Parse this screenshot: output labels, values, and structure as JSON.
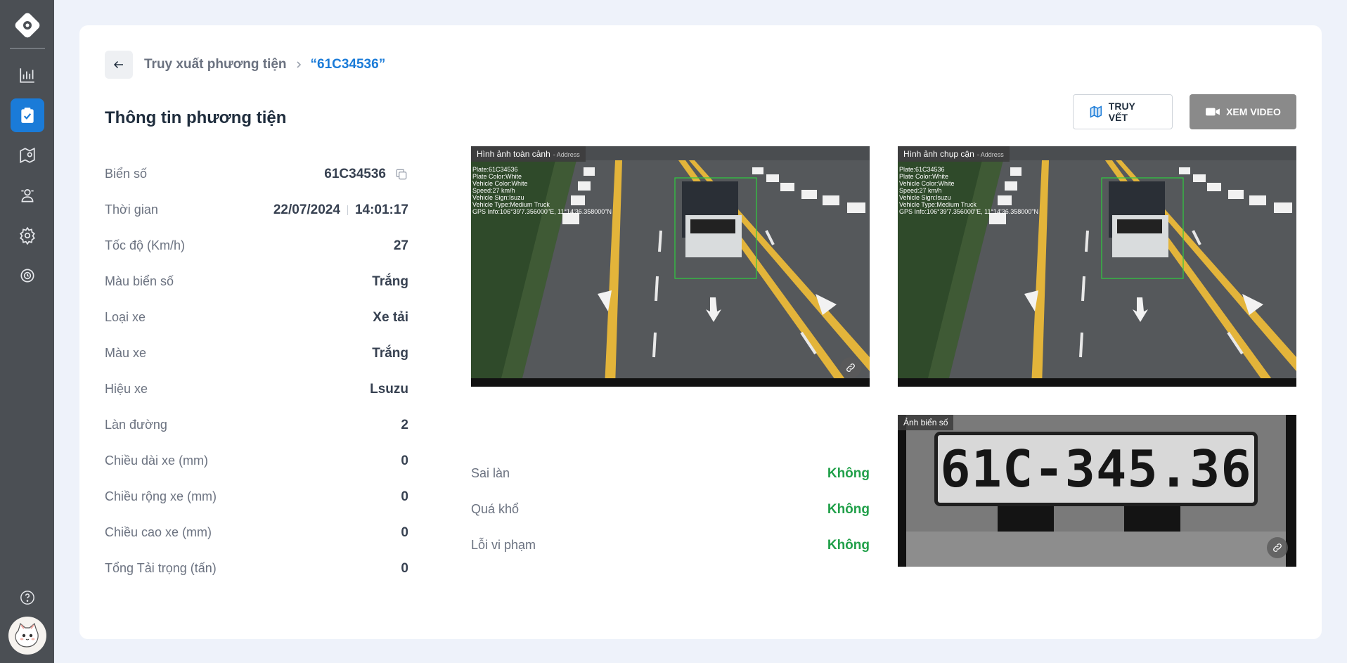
{
  "breadcrumb": {
    "parent": "Truy xuất phương tiện",
    "current": "“61C34536”"
  },
  "section_title": "Thông tin phương tiện",
  "info": {
    "plate": {
      "label": "Biển số",
      "value": "61C34536"
    },
    "time": {
      "label": "Thời gian",
      "date": "22/07/2024",
      "clock": "14:01:17"
    },
    "speed": {
      "label": "Tốc độ (Km/h)",
      "value": "27"
    },
    "plate_color": {
      "label": "Màu biển số",
      "value": "Trắng"
    },
    "vehicle_type": {
      "label": "Loại xe",
      "value": "Xe tải"
    },
    "vehicle_color": {
      "label": "Màu xe",
      "value": "Trắng"
    },
    "brand": {
      "label": "Hiệu xe",
      "value": "Lsuzu"
    },
    "lane": {
      "label": "Làn đường",
      "value": "2"
    },
    "length": {
      "label": "Chiều dài xe (mm)",
      "value": "0"
    },
    "width": {
      "label": "Chiều rộng xe (mm)",
      "value": "0"
    },
    "height": {
      "label": "Chiều cao xe (mm)",
      "value": "0"
    },
    "load": {
      "label": "Tổng Tải trọng (tấn)",
      "value": "0"
    }
  },
  "actions": {
    "trace_label": "TRUY VẾT",
    "video_label": "XEM VIDEO"
  },
  "images": {
    "overview": {
      "tag": "Hình ảnh toàn cảnh",
      "tag_extra": "- Address"
    },
    "closeup": {
      "tag": "Hình ảnh chụp cận",
      "tag_extra": "- Address"
    },
    "plate": {
      "tag": "Ảnh biển số",
      "plate_text": "61C-345.36"
    },
    "overlay_lines": [
      "Plate:61C34536",
      "Plate Color:White",
      "Vehicle Color:White",
      "Speed:27 km/h",
      "Vehicle Sign:Isuzu",
      "Vehicle Type:Medium Truck",
      "GPS Info:106°39'7.356000\"E, 11°14'36.358000\"N"
    ]
  },
  "violations": {
    "wrong_lane": {
      "label": "Sai làn",
      "value": "Không"
    },
    "oversize": {
      "label": "Quá khổ",
      "value": "Không"
    },
    "violation_error": {
      "label": "Lỗi vi phạm",
      "value": "Không"
    }
  },
  "colors": {
    "accent": "#1a7bd8",
    "success": "#21a04a",
    "sidebar": "#4b4f54"
  },
  "icons": [
    "logo-icon",
    "chart-icon",
    "clipboard-check-icon",
    "map-pin-icon",
    "users-icon",
    "gear-icon",
    "history-icon",
    "help-icon",
    "avatar",
    "back-arrow-icon",
    "chevron-right-icon",
    "copy-icon",
    "map-icon",
    "video-icon",
    "link-icon"
  ]
}
